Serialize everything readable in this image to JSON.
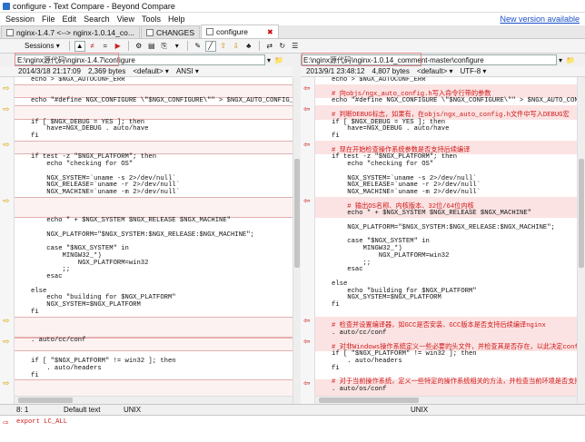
{
  "window": {
    "title": "configure - Text Compare - Beyond Compare"
  },
  "menu": {
    "items": [
      "Session",
      "File",
      "Edit",
      "Search",
      "View",
      "Tools",
      "Help"
    ],
    "update_link": "New version available"
  },
  "tabs": [
    {
      "label": "nginx-1.4.7 <--> nginx-1.0.14_co..."
    },
    {
      "label": "CHANGES"
    },
    {
      "label": "configure"
    }
  ],
  "toolbar": {
    "sessions_label": "Sessions"
  },
  "left": {
    "path": "E:\\nginx源代码\\nginx-1.4.7\\configure",
    "timestamp": "2014/3/18 21:17:09",
    "size": "2,369 bytes",
    "format": "<default>",
    "encoding": "ANSI",
    "lines": [
      "echo > $NGX_AUTOCONF_ERR",
      "",
      "",
      "echo \"#define NGX_CONFIGURE \\\"$NGX_CONFIGURE\\\"\" > $NGX_AUTO_CONFIG_H",
      "",
      "",
      "if [ $NGX_DEBUG = YES ]; then",
      "    have=NGX_DEBUG . auto/have",
      "fi",
      "",
      "",
      "if test -z \"$NGX_PLATFORM\"; then",
      "    echo \"checking for OS\"",
      "",
      "    NGX_SYSTEM=`uname -s 2>/dev/null`",
      "    NGX_RELEASE=`uname -r 2>/dev/null`",
      "    NGX_MACHINE=`uname -m 2>/dev/null`",
      "",
      "",
      "",
      "    echo \" + $NGX_SYSTEM $NGX_RELEASE $NGX_MACHINE\"",
      "",
      "    NGX_PLATFORM=\"$NGX_SYSTEM:$NGX_RELEASE:$NGX_MACHINE\";",
      "",
      "    case \"$NGX_SYSTEM\" in",
      "        MINGW32_*)",
      "            NGX_PLATFORM=win32",
      "        ;;",
      "    esac",
      "",
      "else",
      "    echo \"building for $NGX_PLATFORM\"",
      "    NGX_SYSTEM=$NGX_PLATFORM",
      "fi",
      "",
      "",
      "",
      ". auto/cc/conf",
      "",
      "",
      "if [ \"$NGX_PLATFORM\" != win32 ]; then",
      "    . auto/headers",
      "fi",
      "",
      "",
      "",
      ". auto/os/conf"
    ]
  },
  "right": {
    "path": "E:\\nginx源代码\\nginx-1.0.14_comment-master\\configure",
    "timestamp": "2013/9/1 23:48:12",
    "size": "4,807 bytes",
    "format": "<default>",
    "encoding": "UTF-8",
    "lines": [
      "echo > $NGX_AUTOCONF_ERR",
      "",
      "# 向objs/ngx_auto_config.h写入命令行带的参数",
      "echo \"#define NGX_CONFIGURE \\\"$NGX_CONFIGURE\\\"\" > $NGX_AUTO_CONFIG_H",
      "",
      "# 判断DEBUG标志，如果有，在objs/ngx_auto_config.h文件中写入DEBUG宏",
      "if [ $NGX_DEBUG = YES ]; then",
      "    have=NGX_DEBUG . auto/have",
      "fi",
      "",
      "# 现在开始检查操作系统参数是否支持后续编译",
      "if test -z \"$NGX_PLATFORM\"; then",
      "    echo \"checking for OS\"",
      "",
      "    NGX_SYSTEM=`uname -s 2>/dev/null`",
      "    NGX_RELEASE=`uname -r 2>/dev/null`",
      "    NGX_MACHINE=`uname -m 2>/dev/null`",
      "",
      "    # 输出OS名称、内核版本、32位/64位内核",
      "    echo \" + $NGX_SYSTEM $NGX_RELEASE $NGX_MACHINE\"",
      "",
      "    NGX_PLATFORM=\"$NGX_SYSTEM:$NGX_RELEASE:$NGX_MACHINE\";",
      "",
      "    case \"$NGX_SYSTEM\" in",
      "        MINGW32_*)",
      "            NGX_PLATFORM=win32",
      "        ;;",
      "    esac",
      "",
      "else",
      "    echo \"building for $NGX_PLATFORM\"",
      "    NGX_SYSTEM=$NGX_PLATFORM",
      "fi",
      "",
      "",
      "# 检查并设置编译器，如GCC是否安装、GCC版本是否支持后续编译nginx",
      ". auto/cc/conf",
      "",
      "# 对非Windows操作系统定义一些必要的头文件，并检查其是否存在，以此决定configure后续步骤是否可以成功",
      "if [ \"$NGX_PLATFORM\" != win32 ]; then",
      "    . auto/headers",
      "fi",
      "",
      "# 对于当前操作系统，定义一些特定的操作系统相关的方法，并检查当前环境是否支持。",
      ". auto/os/conf"
    ]
  },
  "status": {
    "position": "8: 1",
    "mode": "Default text",
    "line_end_left": "UNIX",
    "line_end_right": "UNIX"
  },
  "bottom_pane": {
    "line": "export LC_ALL"
  }
}
